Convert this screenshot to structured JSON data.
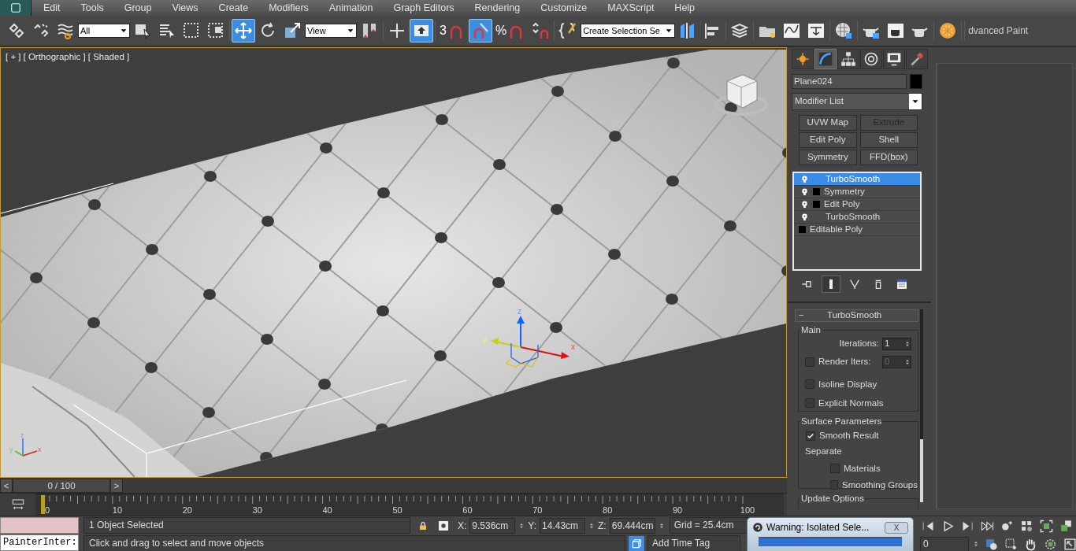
{
  "menu": [
    "Edit",
    "Tools",
    "Group",
    "Views",
    "Create",
    "Modifiers",
    "Animation",
    "Graph Editors",
    "Rendering",
    "Customize",
    "MAXScript",
    "Help"
  ],
  "toolbar": {
    "dropdowns": [
      "All",
      "View",
      "Create Selection Se"
    ],
    "buttons": [
      {
        "selected": false
      },
      {
        "selected": false
      },
      {
        "selected": false
      },
      {
        "selected": false
      },
      {
        "selected": false
      },
      {
        "selected": false
      },
      {
        "selected": false
      },
      {
        "selected": true
      },
      {
        "selected": false
      },
      {
        "selected": false
      },
      {
        "selected": false
      },
      {
        "selected": false
      },
      {
        "selected": true
      },
      {
        "label": "3",
        "selected": false
      },
      {
        "selected": true
      },
      {
        "label": "%",
        "selected": false
      },
      {
        "selected": false
      },
      {
        "selected": false
      },
      {
        "selected": false
      },
      {
        "selected": false
      },
      {
        "selected": false
      },
      {
        "selected": false
      },
      {
        "selected": false
      },
      {
        "selected": false
      },
      {
        "selected": false
      },
      {
        "selected": false
      },
      {
        "selected": false
      },
      {
        "selected": false
      },
      {
        "selected": false
      }
    ],
    "workspace": "dvanced Paint"
  },
  "viewport": {
    "labels": [
      "[ + ]",
      "[ Orthographic ]",
      "[ Shaded ]"
    ],
    "gizmo_axes": [
      "z",
      "y",
      "x"
    ],
    "tripod_axes": [
      "z",
      "y",
      "x"
    ]
  },
  "command_panel": {
    "tabs": [
      {
        "selected": false
      },
      {
        "selected": true
      },
      {
        "selected": false
      },
      {
        "selected": false
      },
      {
        "selected": false
      },
      {
        "selected": false
      }
    ],
    "object_name": "Plane024",
    "modifier_list": "Modifier List",
    "modifier_buttons": [
      {
        "label": "UVW Map",
        "disabled": false
      },
      {
        "label": "Extrude",
        "disabled": true
      },
      {
        "label": "Edit Poly",
        "disabled": false
      },
      {
        "label": "Shell",
        "disabled": false
      },
      {
        "label": "Symmetry",
        "disabled": false
      },
      {
        "label": "FFD(box)",
        "disabled": false
      }
    ],
    "stack": [
      {
        "kind": "modifier",
        "label": "TurboSmooth",
        "expandable": false,
        "selected": true
      },
      {
        "kind": "modifier",
        "label": "Symmetry",
        "expandable": true,
        "selected": false
      },
      {
        "kind": "modifier",
        "label": "Edit Poly",
        "expandable": true,
        "selected": false
      },
      {
        "kind": "modifier",
        "label": "TurboSmooth",
        "expandable": false,
        "selected": false
      },
      {
        "kind": "base",
        "label": "Editable Poly",
        "expandable": true,
        "selected": false
      }
    ],
    "stack_tools": [
      {
        "selected": false
      },
      {
        "selected": true
      },
      {
        "selected": false
      },
      {
        "selected": false
      },
      {
        "selected": false
      }
    ],
    "rollout": {
      "sign": "−",
      "title": "TurboSmooth",
      "main": {
        "title": "Main",
        "iterations_label": "Iterations:",
        "iterations": "1",
        "render_iters_label": "Render Iters:",
        "render_iters": "0",
        "render_iters_checked": false,
        "checks": [
          {
            "label": "Isoline Display",
            "checked": false
          },
          {
            "label": "Explicit Normals",
            "checked": false
          }
        ]
      },
      "surface": {
        "title": "Surface Parameters",
        "smooth_result": {
          "label": "Smooth Result",
          "checked": true
        },
        "separate": "Separate",
        "checks": [
          {
            "label": "Materials",
            "checked": false
          },
          {
            "label": "Smoothing Groups",
            "checked": false
          }
        ]
      },
      "update_title": "Update Options"
    }
  },
  "timeline": {
    "frame": "0 / 100",
    "level": 0,
    "prev": "<",
    "next": ">",
    "ticks": [
      "0",
      "10",
      "20",
      "30",
      "40",
      "50",
      "60",
      "70",
      "80",
      "90",
      "100"
    ]
  },
  "status": {
    "script_field": "PainterInter:",
    "selection": "1 Object Selected",
    "prompt": "Click and drag to select and move objects",
    "coords": [
      {
        "axis": "X:",
        "value": "9.536cm"
      },
      {
        "axis": "Y:",
        "value": "14.43cm"
      },
      {
        "axis": "Z:",
        "value": "69.444cm"
      }
    ],
    "grid": "Grid = 25.4cm",
    "time_tag": "Add Time Tag",
    "frame": "0"
  },
  "dialog": {
    "title": "Warning: Isolated Sele...",
    "close": "X"
  }
}
